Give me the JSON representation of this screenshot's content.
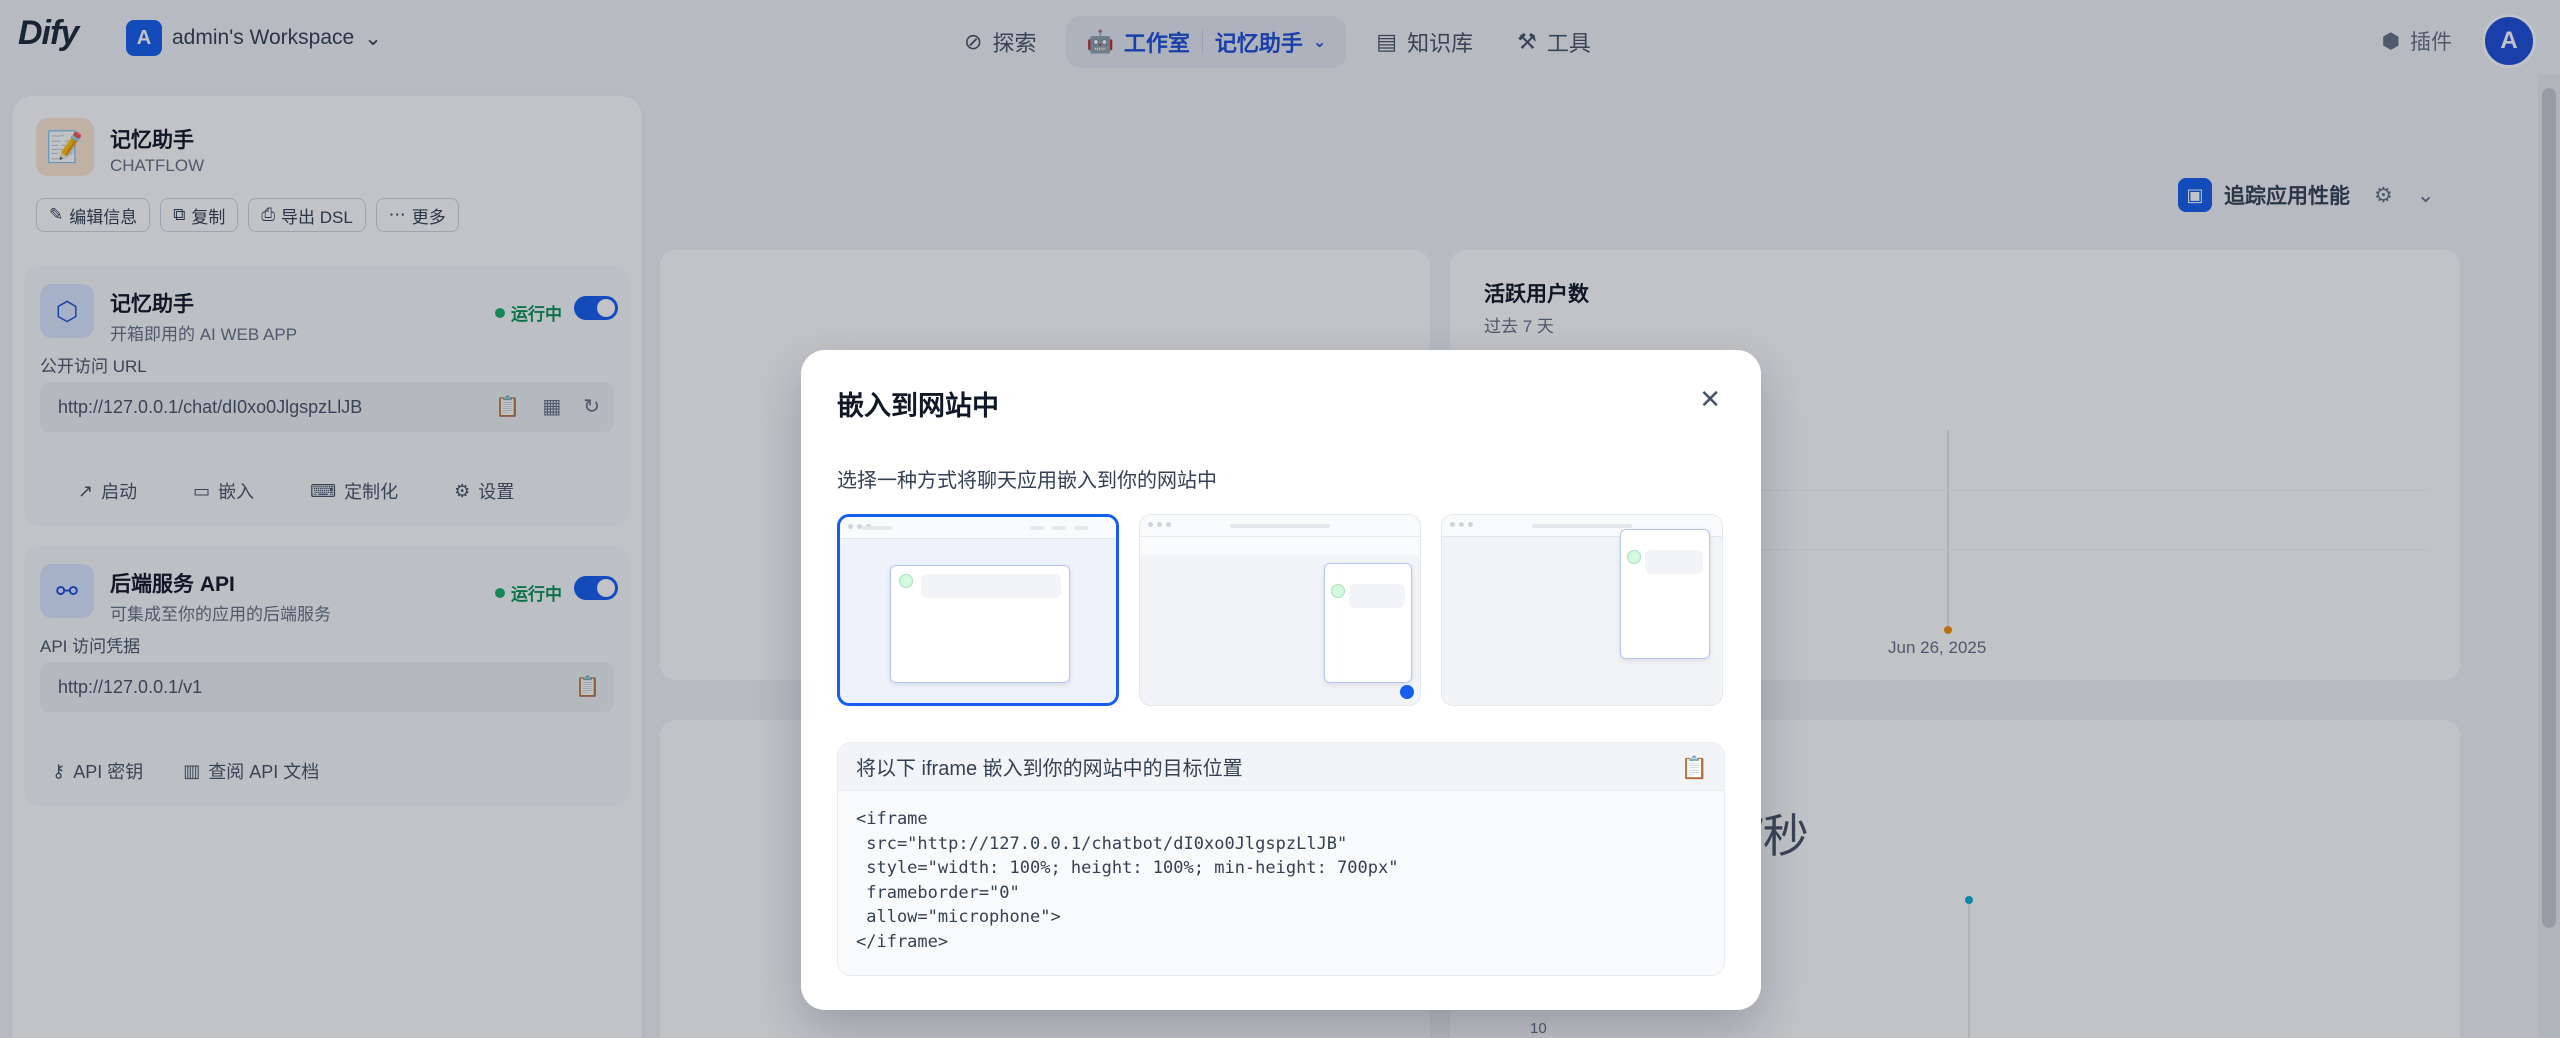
{
  "header": {
    "logo": "Dify",
    "workspace_initial": "A",
    "workspace_name": "admin's Workspace",
    "nav": {
      "explore": "探索",
      "studio": "工作室",
      "current_app": "记忆助手",
      "knowledge": "知识库",
      "tools": "工具"
    },
    "plugins": "插件",
    "user_initial": "A"
  },
  "sidebar": {
    "app_name": "记忆助手",
    "app_type": "CHATFLOW",
    "actions": {
      "edit": "编辑信息",
      "copy": "复制",
      "export": "导出 DSL",
      "more": "更多"
    },
    "webapp": {
      "title": "记忆助手",
      "desc": "开箱即用的 AI WEB APP",
      "status": "运行中",
      "url_label": "公开访问 URL",
      "url": "http://127.0.0.1/chat/dI0xo0JlgspzLlJB",
      "launch": "启动",
      "embed": "嵌入",
      "customize": "定制化",
      "settings": "设置"
    },
    "api": {
      "title": "后端服务 API",
      "desc": "可集成至你的应用的后端服务",
      "status": "运行中",
      "url_label": "API 访问凭据",
      "url": "http://127.0.0.1/v1",
      "api_key": "API 密钥",
      "api_docs": "查阅 API 文档"
    }
  },
  "background": {
    "trace_label": "追踪应用性能",
    "active_users_title": "活跃用户数",
    "active_users_sub": "过去 7 天",
    "chart_date": "Jun 26, 2025",
    "big_label": "/秒",
    "tick": "10"
  },
  "modal": {
    "title": "嵌入到网站中",
    "subtitle": "选择一种方式将聊天应用嵌入到你的网站中",
    "code_header": "将以下 iframe 嵌入到你的网站中的目标位置",
    "code": "<iframe\n src=\"http://127.0.0.1/chatbot/dI0xo0JlgspzLlJB\"\n style=\"width: 100%; height: 100%; min-height: 700px\"\n frameborder=\"0\"\n allow=\"microphone\">\n</iframe>"
  },
  "colors": {
    "primary": "#155eef",
    "running": "#17b26a",
    "selected_border": "#155eef"
  }
}
